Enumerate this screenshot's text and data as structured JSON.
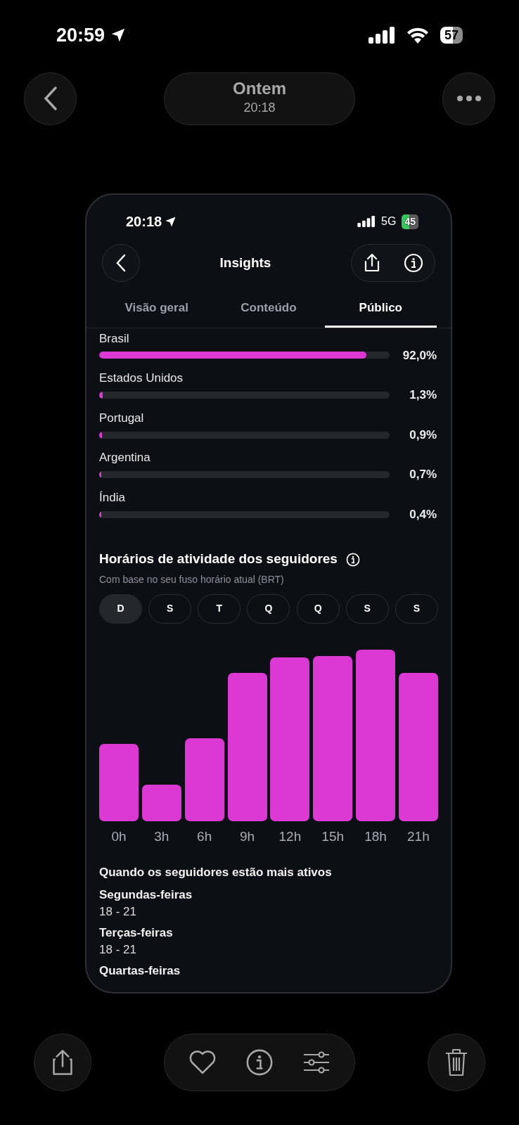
{
  "status_bar": {
    "time": "20:59",
    "battery": "57"
  },
  "top_bar": {
    "title": "Ontem",
    "subtitle": "20:18"
  },
  "screenshot": {
    "status_bar": {
      "time": "20:18",
      "network": "5G",
      "battery": "45"
    },
    "title": "Insights",
    "tabs": [
      {
        "label": "Visão geral",
        "selected": false
      },
      {
        "label": "Conteúdo",
        "selected": false
      },
      {
        "label": "Público",
        "selected": true
      }
    ],
    "countries": [
      {
        "name": "Brasil",
        "level": 0.92,
        "reading": "92,0%"
      },
      {
        "name": "Estados Unidos",
        "level": 0.013,
        "reading": "1,3%"
      },
      {
        "name": "Portugal",
        "level": 0.009,
        "reading": "0,9%"
      },
      {
        "name": "Argentina",
        "level": 0.007,
        "reading": "0,7%"
      },
      {
        "name": "Índia",
        "level": 0.004,
        "reading": "0,4%"
      }
    ],
    "activity": {
      "title": "Horários de atividade dos seguidores",
      "subtitle": "Com base no seu fuso horário atual (BRT)",
      "days": [
        {
          "label": "D",
          "selected": true
        },
        {
          "label": "S",
          "selected": false
        },
        {
          "label": "T",
          "selected": false
        },
        {
          "label": "Q",
          "selected": false
        },
        {
          "label": "Q",
          "selected": false
        },
        {
          "label": "S",
          "selected": false
        },
        {
          "label": "S",
          "selected": false
        }
      ],
      "hours": [
        "0h",
        "3h",
        "6h",
        "9h",
        "12h",
        "15h",
        "18h",
        "21h"
      ]
    },
    "most_active": {
      "title": "Quando os seguidores estão mais ativos",
      "items": [
        {
          "day": "Segundas-feiras",
          "range": "18 - 21"
        },
        {
          "day": "Terças-feiras",
          "range": "18 - 21"
        },
        {
          "day": "Quartas-feiras"
        }
      ]
    }
  }
}
